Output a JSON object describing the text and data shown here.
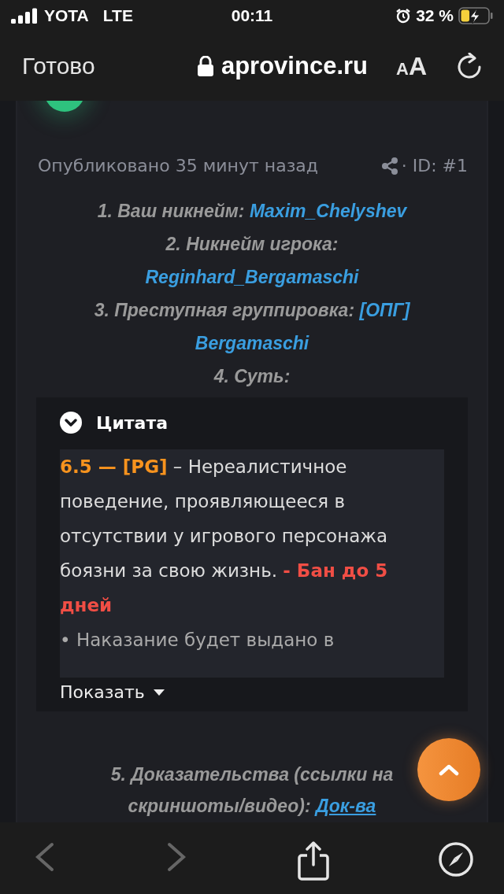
{
  "status_bar": {
    "carrier": "YOTA",
    "network": "LTE",
    "time": "00:11",
    "battery": "32 %"
  },
  "browser": {
    "done": "Готово",
    "url": "aprovince.ru",
    "text_size": "AA"
  },
  "post": {
    "published": "Опубликовано 35 минут назад",
    "post_id": "· ID: #1",
    "fields": [
      {
        "label": "1. Ваш никнейм:",
        "value": "Maxim_Chelyshev"
      },
      {
        "label": "2. Никнейм игрока:",
        "value": "Reginhard_Bergamaschi"
      },
      {
        "label": "3. Преступная группировка:",
        "value": "[ОПГ] Bergamaschi"
      },
      {
        "label": "4. Суть:"
      }
    ],
    "quote": {
      "title": "Цитата",
      "expanded": false,
      "paragraphs": [
        [
          {
            "kind": "rule",
            "text": "6.5 — [PG]"
          },
          {
            "kind": "text",
            "text": " – Нереалистичное поведение, проявляющееся в отсутствии у игрового персонажа боязни за свою жизнь. "
          },
          {
            "kind": "penalty",
            "text": "- Бан до 5 дней"
          }
        ],
        [
          {
            "kind": "note",
            "text": "• Наказание будет выдано в"
          }
        ]
      ],
      "expand": "Показать"
    },
    "evidence": {
      "label": "5. Доказательства (ссылки на скриншоты/видео):",
      "link": "Док-ва"
    }
  },
  "toolbar": {
    "back_disabled": true,
    "forward_disabled": true
  }
}
